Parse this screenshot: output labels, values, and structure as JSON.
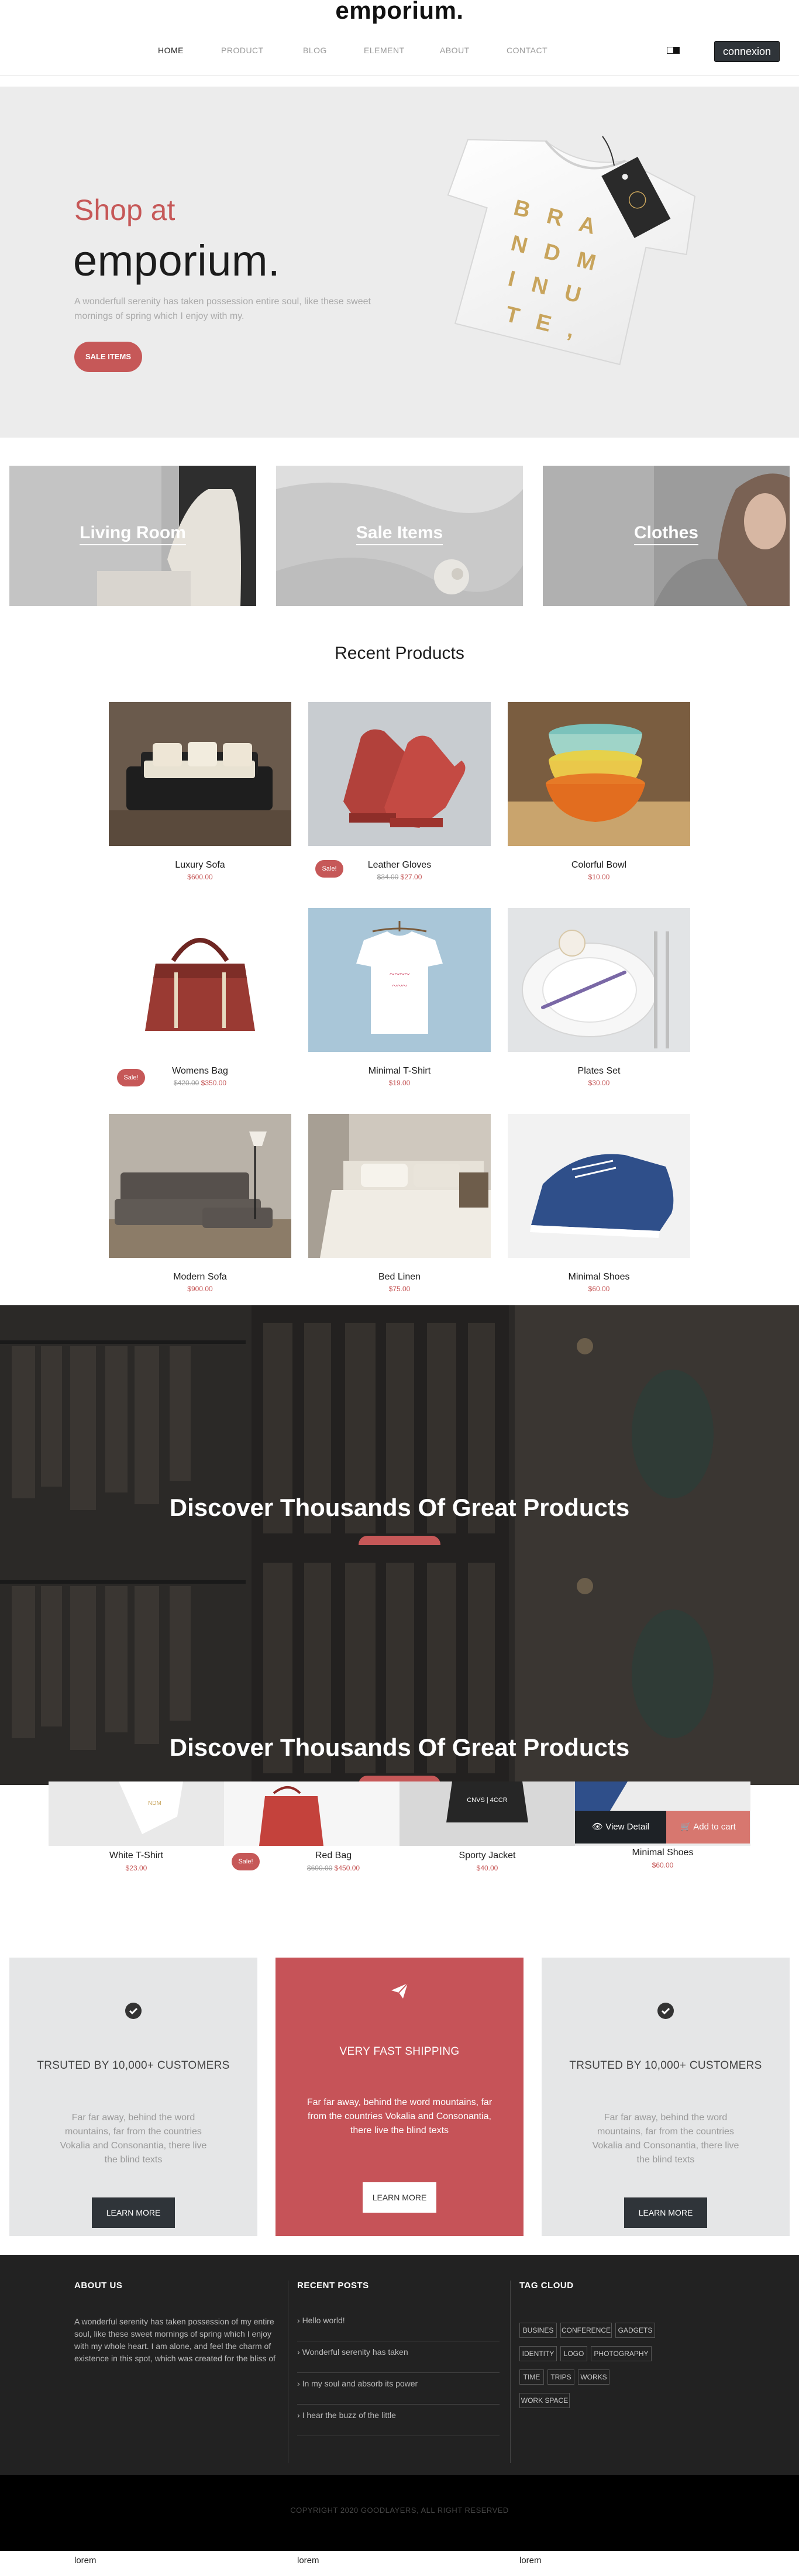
{
  "header": {
    "logo": "emporium.",
    "nav": [
      "HOME",
      "PRODUCT",
      "BLOG",
      "ELEMENT",
      "ABOUT",
      "CONTACT"
    ],
    "login_label": "connexion"
  },
  "hero": {
    "pre_title": "Shop at",
    "title": "emporium.",
    "text": "A wonderfull serenity has taken possession entire soul, like these sweet mornings of spring which I enjoy with my.",
    "button": "SALE ITEMS",
    "tshirt_print": [
      "B R A",
      "N D M",
      "I N U",
      "T E ,"
    ]
  },
  "categories": [
    "Living Room",
    "Sale Items",
    "Clothes"
  ],
  "recent": {
    "title": "Recent Products",
    "products": [
      {
        "name": "Luxury Sofa",
        "price": "$600.00",
        "old": "",
        "sale": false
      },
      {
        "name": "Leather Gloves",
        "price": "$27.00",
        "old": "$34.00",
        "sale": true
      },
      {
        "name": "Colorful Bowl",
        "price": "$10.00",
        "old": "",
        "sale": false
      },
      {
        "name": "Womens Bag",
        "price": "$350.00",
        "old": "$420.00",
        "sale": true
      },
      {
        "name": "Minimal T-Shirt",
        "price": "$19.00",
        "old": "",
        "sale": false
      },
      {
        "name": "Plates Set",
        "price": "$30.00",
        "old": "",
        "sale": false
      },
      {
        "name": "Modern Sofa",
        "price": "$900.00",
        "old": "",
        "sale": false
      },
      {
        "name": "Bed Linen",
        "price": "$75.00",
        "old": "",
        "sale": false
      },
      {
        "name": "Minimal Shoes",
        "price": "$60.00",
        "old": "",
        "sale": false
      }
    ],
    "sale_label": "Sale!"
  },
  "banners": [
    "Discover Thousands Of Great Products",
    "Discover Thousands Of Great Products"
  ],
  "carousel": {
    "items": [
      {
        "name": "White T-Shirt",
        "price": "$23.00",
        "old": ""
      },
      {
        "name": "Red Bag",
        "price": "$450.00",
        "old": "$600.00"
      },
      {
        "name": "Sporty Jacket",
        "price": "$40.00",
        "old": ""
      },
      {
        "name": "Minimal Shoes",
        "price": "$60.00",
        "old": ""
      }
    ],
    "jacket_print": "CNVS | 4CCR",
    "view_detail": "View Detail",
    "add_to_cart": "Add to cart",
    "sale_label": "Sale!"
  },
  "features": [
    {
      "title": "TRSUTED BY 10,000+ CUSTOMERS",
      "text": "Far far away, behind the word mountains, far from the countries Vokalia and Consonantia, there live the blind texts",
      "button": "LEARN MORE",
      "icon": "check-circle-icon"
    },
    {
      "title": "VERY FAST SHIPPING",
      "text": "Far far away, behind the word mountains, far from the countries Vokalia and Consonantia, there live the blind texts",
      "button": "LEARN MORE",
      "icon": "paper-plane-icon"
    },
    {
      "title": "TRSUTED BY 10,000+ CUSTOMERS",
      "text": "Far far away, behind the word mountains, far from the countries Vokalia and Consonantia, there live the blind texts",
      "button": "LEARN MORE",
      "icon": "check-circle-icon"
    }
  ],
  "footer": {
    "about_title": "ABOUT US",
    "about_text": "A wonderful serenity has taken possession of my entire soul, like these sweet mornings of spring which I enjoy with my whole heart. I am alone, and feel the charm of existence in this spot, which was created for the bliss of",
    "posts_title": "RECENT POSTS",
    "posts": [
      "Hello world!",
      "Wonderful serenity has taken",
      "In my soul and absorb its power",
      "I hear the buzz of the little"
    ],
    "tags_title": "TAG CLOUD",
    "tags": [
      "BUSINES",
      "CONFERENCE",
      "GADGETS",
      "IDENTITY",
      "LOGO",
      "PHOTOGRAPHY",
      "TIME",
      "TRIPS",
      "WORKS",
      "WORK SPACE"
    ],
    "copyright": "COPYRIGHT 2020 GOODLAYERS, ALL RIGHT RESERVED"
  },
  "bottom_labels": [
    "lorem",
    "lorem",
    "lorem"
  ],
  "colors": {
    "accent": "#c65858",
    "dark": "#222222",
    "hero_bg": "#ececec"
  }
}
